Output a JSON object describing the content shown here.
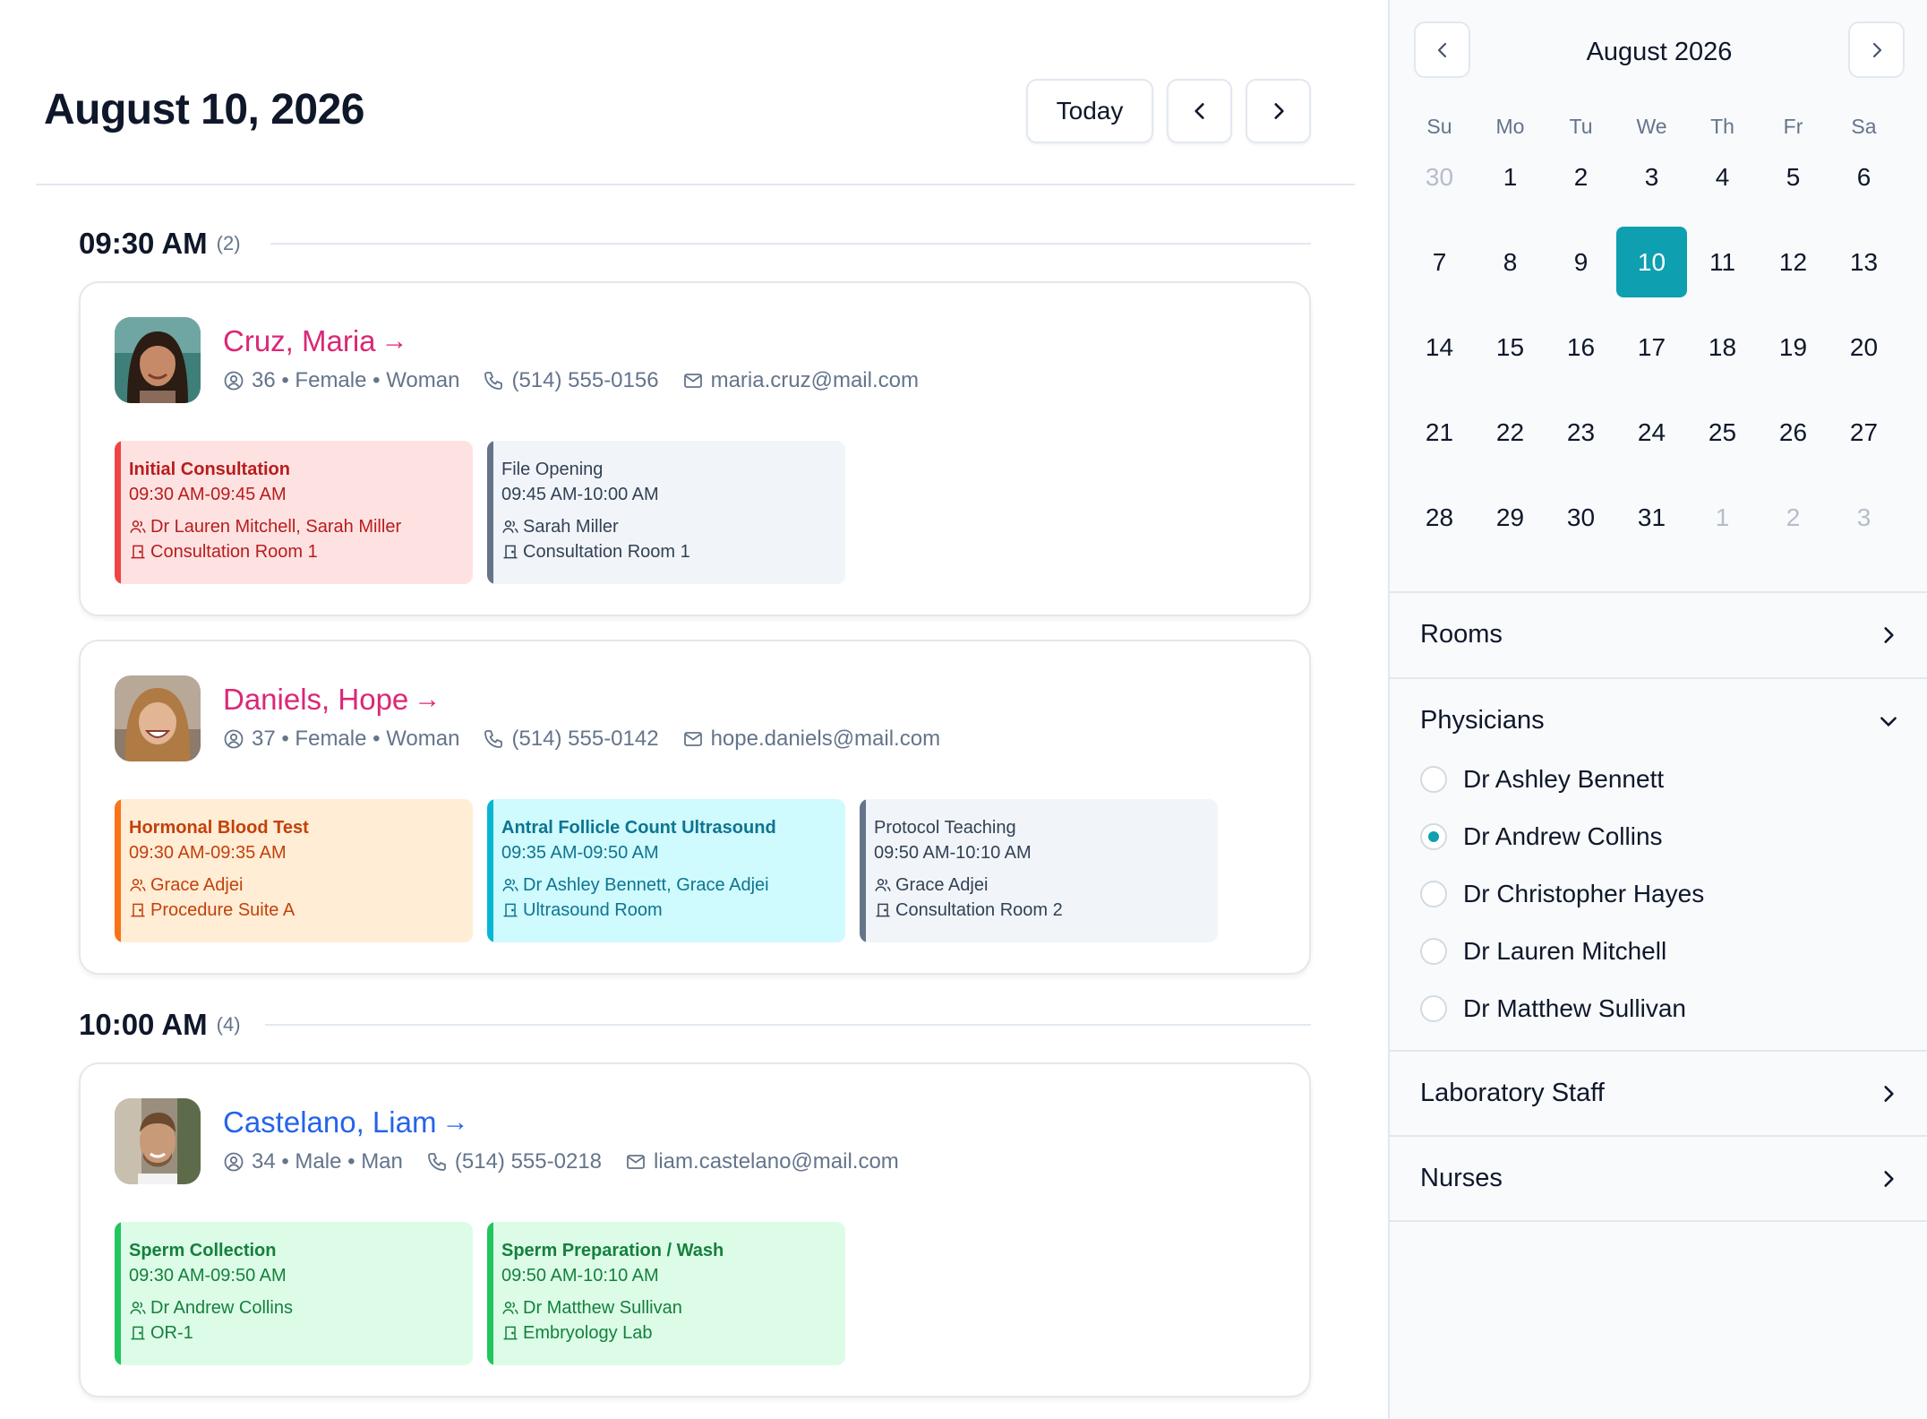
{
  "header": {
    "title": "August 10, 2026",
    "today_label": "Today",
    "prev_icon": "chevron-left-icon",
    "next_icon": "chevron-right-icon"
  },
  "slots": [
    {
      "time": "09:30 AM",
      "count": "(2)",
      "patients": [
        {
          "name": "Cruz, Maria",
          "name_color": "#db2777",
          "details": "36 • Female • Woman",
          "phone": "(514) 555-0156",
          "email": "maria.cruz@mail.com",
          "appointments": [
            {
              "title": "Initial Consultation",
              "time": "09:30 AM-09:45 AM",
              "staff": "Dr Lauren Mitchell, Sarah Miller",
              "room": "Consultation Room 1"
            },
            {
              "title": "File Opening",
              "time": "09:45 AM-10:00 AM",
              "staff": "Sarah Miller",
              "room": "Consultation Room 1"
            }
          ]
        },
        {
          "name": "Daniels, Hope",
          "name_color": "#db2777",
          "details": "37 • Female • Woman",
          "phone": "(514) 555-0142",
          "email": "hope.daniels@mail.com",
          "appointments": [
            {
              "title": "Hormonal Blood Test",
              "time": "09:30 AM-09:35 AM",
              "staff": "Grace Adjei",
              "room": "Procedure Suite A"
            },
            {
              "title": "Antral Follicle Count Ultrasound",
              "time": "09:35 AM-09:50 AM",
              "staff": "Dr Ashley Bennett, Grace Adjei",
              "room": "Ultrasound Room"
            },
            {
              "title": "Protocol Teaching",
              "time": "09:50 AM-10:10 AM",
              "staff": "Grace Adjei",
              "room": "Consultation Room 2"
            }
          ]
        }
      ]
    },
    {
      "time": "10:00 AM",
      "count": "(4)",
      "patients": [
        {
          "name": "Castelano, Liam",
          "name_color": "#2563eb",
          "details": "34 • Male • Man",
          "phone": "(514) 555-0218",
          "email": "liam.castelano@mail.com",
          "appointments": [
            {
              "title": "Sperm Collection",
              "time": "09:30 AM-09:50 AM",
              "staff": "Dr Andrew Collins",
              "room": "OR-1"
            },
            {
              "title": "Sperm Preparation / Wash",
              "time": "09:50 AM-10:10 AM",
              "staff": "Dr Matthew Sullivan",
              "room": "Embryology Lab"
            }
          ]
        }
      ]
    }
  ],
  "sidebar": {
    "calendar": {
      "month_title": "August 2026",
      "weekdays": [
        "Su",
        "Mo",
        "Tu",
        "We",
        "Th",
        "Fr",
        "Sa"
      ],
      "weeks": [
        [
          "30",
          "1",
          "2",
          "3",
          "4",
          "5",
          "6"
        ],
        [
          "7",
          "8",
          "9",
          "10",
          "11",
          "12",
          "13"
        ],
        [
          "14",
          "15",
          "16",
          "17",
          "18",
          "19",
          "20"
        ],
        [
          "21",
          "22",
          "23",
          "24",
          "25",
          "26",
          "27"
        ],
        [
          "28",
          "29",
          "30",
          "31",
          "1",
          "2",
          "3"
        ]
      ],
      "selected_day": "10",
      "accent_color": "#0e9fb0"
    },
    "rooms_label": "Rooms",
    "physicians_label": "Physicians",
    "physicians": [
      {
        "name": "Dr Ashley Bennett",
        "selected": false
      },
      {
        "name": "Dr Andrew Collins",
        "selected": true
      },
      {
        "name": "Dr Christopher Hayes",
        "selected": false
      },
      {
        "name": "Dr Lauren Mitchell",
        "selected": false
      },
      {
        "name": "Dr Matthew Sullivan",
        "selected": false
      }
    ],
    "lab_staff_label": "Laboratory Staff",
    "nurses_label": "Nurses"
  }
}
